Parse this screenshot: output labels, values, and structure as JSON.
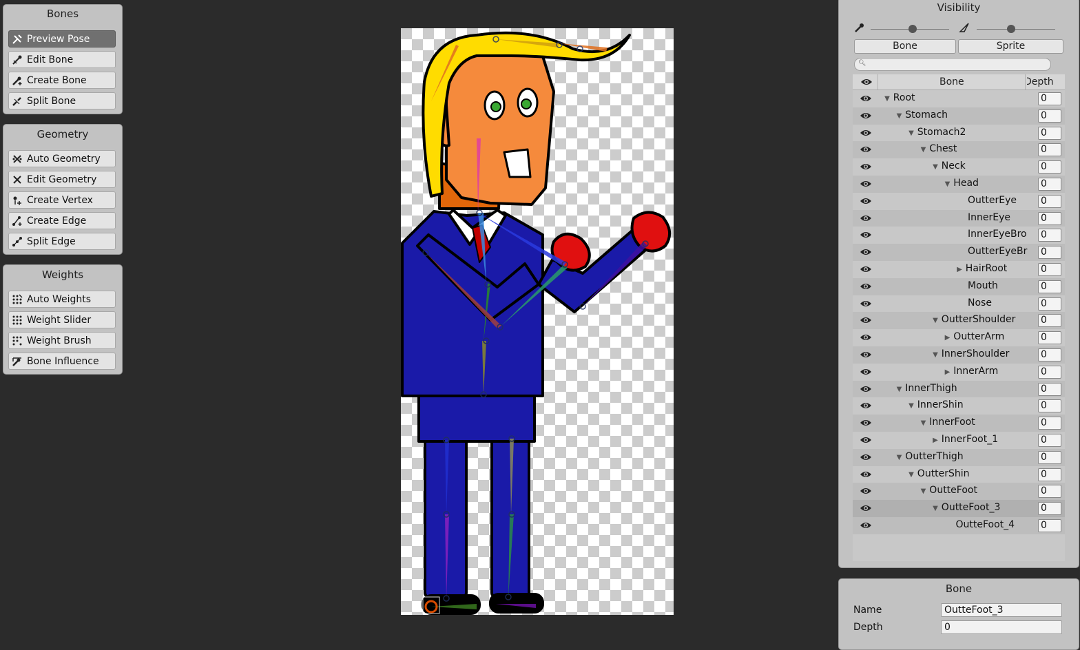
{
  "bones_panel": {
    "title": "Bones",
    "tools": [
      {
        "label": "Preview Pose",
        "icon": "preview-pose-icon"
      },
      {
        "label": "Edit Bone",
        "icon": "edit-bone-icon"
      },
      {
        "label": "Create Bone",
        "icon": "create-bone-icon"
      },
      {
        "label": "Split Bone",
        "icon": "split-bone-icon"
      }
    ]
  },
  "geometry_panel": {
    "title": "Geometry",
    "tools": [
      {
        "label": "Auto Geometry",
        "icon": "auto-geometry-icon"
      },
      {
        "label": "Edit Geometry",
        "icon": "edit-geometry-icon"
      },
      {
        "label": "Create Vertex",
        "icon": "create-vertex-icon"
      },
      {
        "label": "Create Edge",
        "icon": "create-edge-icon"
      },
      {
        "label": "Split Edge",
        "icon": "split-edge-icon"
      }
    ]
  },
  "weights_panel": {
    "title": "Weights",
    "tools": [
      {
        "label": "Auto Weights",
        "icon": "auto-weights-icon"
      },
      {
        "label": "Weight Slider",
        "icon": "weight-slider-icon"
      },
      {
        "label": "Weight Brush",
        "icon": "weight-brush-icon"
      },
      {
        "label": "Bone Influence",
        "icon": "bone-influence-icon"
      }
    ]
  },
  "visibility": {
    "title": "Visibility",
    "tabs": {
      "bone": "Bone",
      "sprite": "Sprite"
    },
    "search": {
      "value": ""
    },
    "columns": {
      "bone": "Bone",
      "depth": "Depth"
    },
    "rows": [
      {
        "name": "Root",
        "level": 0,
        "toggle": "open",
        "depth": "0"
      },
      {
        "name": "Stomach",
        "level": 1,
        "toggle": "open",
        "depth": "0"
      },
      {
        "name": "Stomach2",
        "level": 2,
        "toggle": "open",
        "depth": "0"
      },
      {
        "name": "Chest",
        "level": 3,
        "toggle": "open",
        "depth": "0"
      },
      {
        "name": "Neck",
        "level": 4,
        "toggle": "open",
        "depth": "0"
      },
      {
        "name": "Head",
        "level": 5,
        "toggle": "open",
        "depth": "0"
      },
      {
        "name": "OutterEye",
        "level": 6,
        "toggle": "none",
        "depth": "0"
      },
      {
        "name": "InnerEye",
        "level": 6,
        "toggle": "none",
        "depth": "0"
      },
      {
        "name": "InnerEyeBro",
        "level": 6,
        "toggle": "none",
        "depth": "0"
      },
      {
        "name": "OutterEyeBr",
        "level": 6,
        "toggle": "none",
        "depth": "0"
      },
      {
        "name": "HairRoot",
        "level": 6,
        "toggle": "closed",
        "depth": "0"
      },
      {
        "name": "Mouth",
        "level": 6,
        "toggle": "none",
        "depth": "0"
      },
      {
        "name": "Nose",
        "level": 6,
        "toggle": "none",
        "depth": "0"
      },
      {
        "name": "OutterShoulder",
        "level": 4,
        "toggle": "open",
        "depth": "0"
      },
      {
        "name": "OutterArm",
        "level": 5,
        "toggle": "closed",
        "depth": "0"
      },
      {
        "name": "InnerShoulder",
        "level": 4,
        "toggle": "open",
        "depth": "0"
      },
      {
        "name": "InnerArm",
        "level": 5,
        "toggle": "closed",
        "depth": "0"
      },
      {
        "name": "InnerThigh",
        "level": 1,
        "toggle": "open",
        "depth": "0"
      },
      {
        "name": "InnerShin",
        "level": 2,
        "toggle": "open",
        "depth": "0"
      },
      {
        "name": "InnerFoot",
        "level": 3,
        "toggle": "open",
        "depth": "0"
      },
      {
        "name": "InnerFoot_1",
        "level": 4,
        "toggle": "closed",
        "depth": "0"
      },
      {
        "name": "OutterThigh",
        "level": 1,
        "toggle": "open",
        "depth": "0"
      },
      {
        "name": "OutterShin",
        "level": 2,
        "toggle": "open",
        "depth": "0"
      },
      {
        "name": "OutteFoot",
        "level": 3,
        "toggle": "open",
        "depth": "0"
      },
      {
        "name": "OutteFoot_3",
        "level": 4,
        "toggle": "open",
        "depth": "0",
        "selected": true
      },
      {
        "name": "OutteFoot_4",
        "level": 5,
        "toggle": "none",
        "depth": "0"
      }
    ]
  },
  "bone_inspector": {
    "title": "Bone",
    "name_label": "Name",
    "name_value": "OutteFoot_3",
    "depth_label": "Depth",
    "depth_value": "0"
  },
  "colors": {
    "suit": "#1a1aa8",
    "face": "#f58a3c",
    "hair": "#ffdc00",
    "gloves": "#e01010",
    "checker_light": "#ffffff",
    "checker_dark": "#cccccc"
  }
}
